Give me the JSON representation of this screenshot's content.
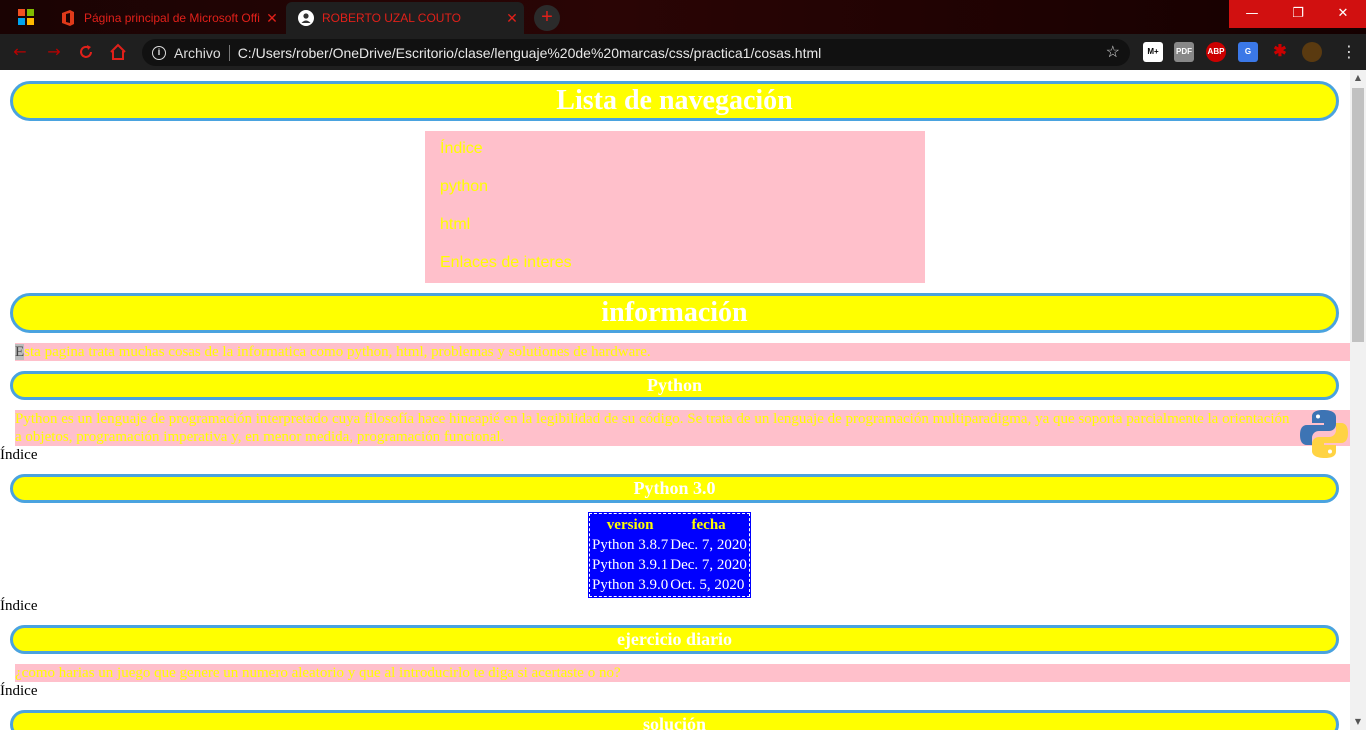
{
  "browser": {
    "tabs": [
      {
        "title": "Página principal de Microsoft Office",
        "active": false
      },
      {
        "title": "ROBERTO UZAL COUTO",
        "active": true
      }
    ],
    "new_tab_label": "+",
    "address": {
      "scheme_label": "Archivo",
      "url": "C:/Users/rober/OneDrive/Escritorio/clase/lenguaje%20de%20marcas/css/practica1/cosas.html"
    },
    "extensions": [
      "M+",
      "PDF",
      "ABP",
      "G",
      "puzzle",
      "avatar"
    ],
    "colors": {
      "accent": "#e0201a",
      "toolbar": "#1f1f1f",
      "close_button": "#d11010"
    }
  },
  "page": {
    "headings": {
      "nav": "Lista de navegación",
      "info": "información",
      "python": "Python",
      "python3": "Python 3.0",
      "ejercicio": "ejercicio diario",
      "solucion": "solución"
    },
    "nav_links": [
      "Índice",
      "python",
      "html",
      "Enlaces de interes"
    ],
    "info_text_first": "E",
    "info_text_rest": "sta pagina trata muchas cosas de la informatica como python, html, problemas y solutiones de hardware.",
    "python_text": "Python es un lenguaje de programación interpretado cuya filosofía hace hincapié en la legibilidad de su código. Se trata de un lenguaje de programación multiparadigma, ya que soporta parcialmente la orientación a objetos, programación imperativa y, en menor medida, programación funcional.",
    "indice_link": "Índice",
    "versions_table": {
      "headers": [
        "version",
        "fecha"
      ],
      "rows": [
        [
          "Python 3.8.7",
          "Dec. 7, 2020"
        ],
        [
          "Python 3.9.1",
          "Dec. 7, 2020"
        ],
        [
          "Python 3.9.0",
          "Oct. 5, 2020"
        ]
      ]
    },
    "ejercicio_text": "¿como harias un juego que genere un numero aleatorio y que al introducirlo te diga si acertaste o no?",
    "colors": {
      "heading_bg": "#ffff00",
      "heading_border": "#4aa3df",
      "text_bg": "#ffc0cb",
      "table_bg": "#0000ff"
    }
  }
}
